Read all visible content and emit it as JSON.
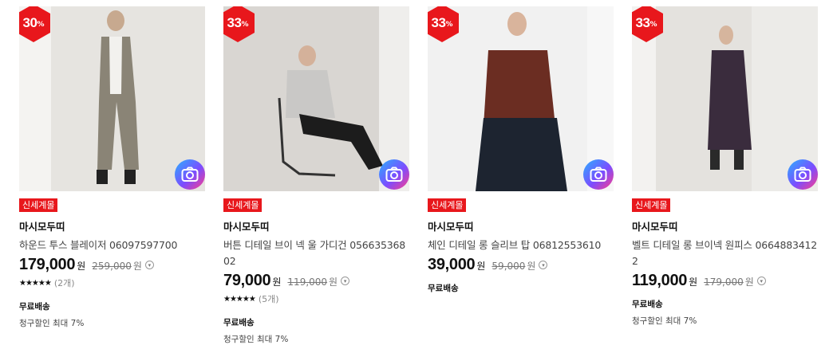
{
  "products": [
    {
      "discount": "30",
      "tag": "신세계몰",
      "brand": "마시모두띠",
      "name": "하운드 투스 블레이저 06097597700",
      "price": "179,000",
      "currency": "원",
      "original_price": "259,000",
      "rating_stars": "★★★★★",
      "review_count": "(2개)",
      "shipping": "무료배송",
      "billing_discount": "청구할인 최대 7%",
      "photo_colors": {
        "bg": "#e6e4e0",
        "body": "#8a8476",
        "accent": "#f2f1ee"
      }
    },
    {
      "discount": "33",
      "tag": "신세계몰",
      "brand": "마시모두띠",
      "name": "버튼 디테일 브이 넥 울 가디건 05663536802",
      "price": "79,000",
      "currency": "원",
      "original_price": "119,000",
      "rating_stars": "★★★★★",
      "review_count": "(5개)",
      "shipping": "무료배송",
      "billing_discount": "청구할인 최대 7%",
      "photo_colors": {
        "bg": "#d9d6d2",
        "body": "#1c1c1c",
        "accent": "#c9c8c6"
      }
    },
    {
      "discount": "33",
      "tag": "신세계몰",
      "brand": "마시모두띠",
      "name": "체인 디테일 롱 슬리브 탑 06812553610",
      "price": "39,000",
      "currency": "원",
      "original_price": "59,000",
      "shipping": "무료배송",
      "photo_colors": {
        "bg": "#f1f1f1",
        "body": "#6b2d22",
        "accent": "#1d2430"
      }
    },
    {
      "discount": "33",
      "tag": "신세계몰",
      "brand": "마시모두띠",
      "name": "벨트 디테일 롱 브이넥 원피스 06648834122",
      "price": "119,000",
      "currency": "원",
      "original_price": "179,000",
      "shipping": "무료배송",
      "billing_discount": "청구할인 최대 7%",
      "photo_colors": {
        "bg": "#e4e2de",
        "body": "#3a2c3d",
        "accent": "#2a2a2a"
      }
    }
  ],
  "icons": {
    "discount_badge": "hexagon-badge",
    "lens": "camera-lens-icon",
    "info": "info-circle-icon"
  },
  "brand_red": "#e8171c"
}
